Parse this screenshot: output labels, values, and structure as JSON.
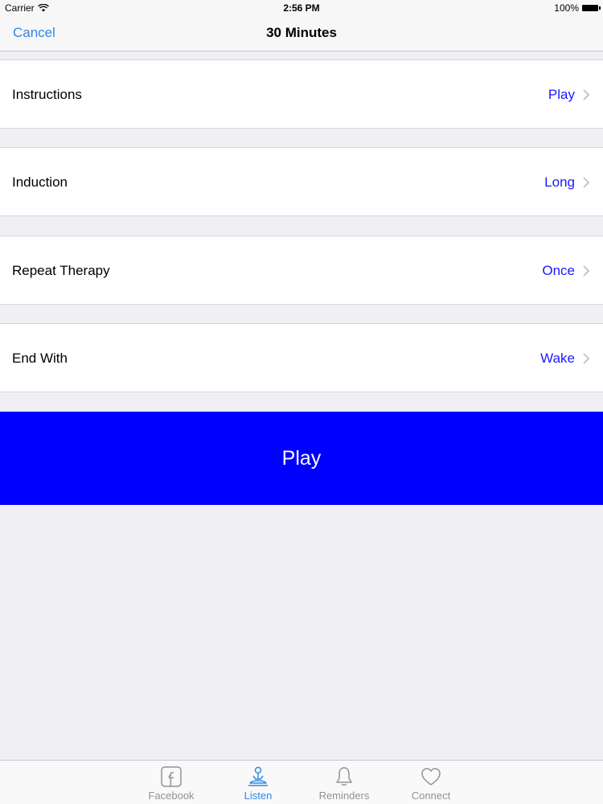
{
  "status_bar": {
    "carrier": "Carrier",
    "time": "2:56 PM",
    "battery": "100%"
  },
  "nav": {
    "cancel_label": "Cancel",
    "title": "30 Minutes"
  },
  "rows": [
    {
      "label": "Instructions",
      "value": "Play"
    },
    {
      "label": "Induction",
      "value": "Long"
    },
    {
      "label": "Repeat Therapy",
      "value": "Once"
    },
    {
      "label": "End With",
      "value": "Wake"
    }
  ],
  "play_button_label": "Play",
  "tabs": [
    {
      "label": "Facebook",
      "icon": "facebook-icon"
    },
    {
      "label": "Listen",
      "icon": "meditation-icon",
      "selected": true
    },
    {
      "label": "Reminders",
      "icon": "bell-icon"
    },
    {
      "label": "Connect",
      "icon": "heart-icon"
    }
  ],
  "colors": {
    "accent": "#2f8ae0",
    "value_text": "#1a1aff",
    "play_button": "#0000ff",
    "tab_inactive": "#929292",
    "background": "#efeff4"
  }
}
